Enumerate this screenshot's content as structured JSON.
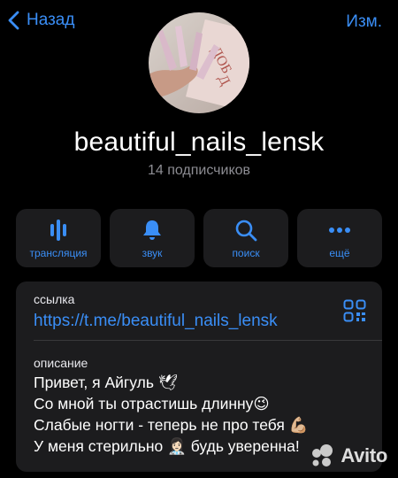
{
  "header": {
    "back_label": "Назад",
    "edit_label": "Изм."
  },
  "profile": {
    "name": "beautiful_nails_lensk",
    "subscribers": "14 подписчиков",
    "avatar_text": "ДОБ Д"
  },
  "actions": [
    {
      "icon": "broadcast-icon",
      "label": "трансляция"
    },
    {
      "icon": "bell-icon",
      "label": "звук"
    },
    {
      "icon": "search-icon",
      "label": "поиск"
    },
    {
      "icon": "more-icon",
      "label": "ещё"
    }
  ],
  "info": {
    "link_caption": "ссылка",
    "link": "https://t.me/beautiful_nails_lensk",
    "description_caption": "описание",
    "description_lines": [
      "Привет, я Айгуль 🕊",
      "Со мной ты отрастишь длинну😉",
      "Слабые ногти - теперь не про тебя 💪🏼",
      "У меня стерильно 👩🏻‍⚕️ будь уверенна!"
    ]
  },
  "watermark": {
    "text": "Avito"
  },
  "colors": {
    "accent": "#3a8ef6",
    "card": "#1c1c1e",
    "background": "#000000"
  }
}
